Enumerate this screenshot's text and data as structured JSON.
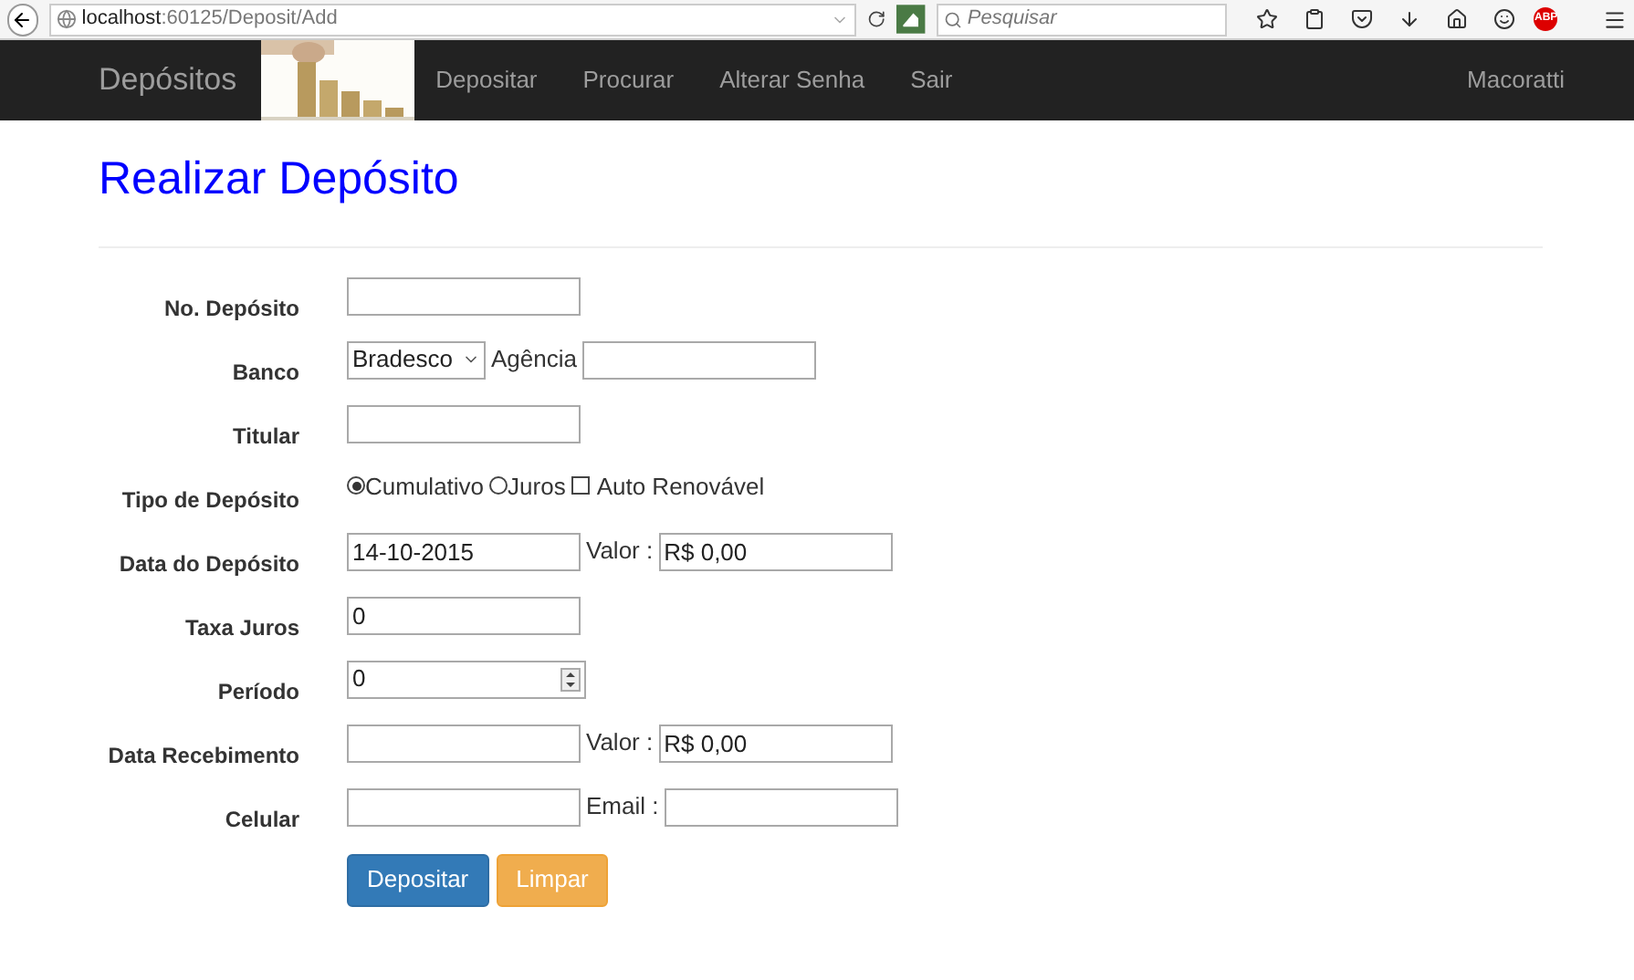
{
  "browser": {
    "url_host": "localhost",
    "url_path": ":60125/Deposit/Add",
    "search_placeholder": "Pesquisar",
    "addon_badge": "ABP"
  },
  "navbar": {
    "brand": "Depósitos",
    "links": [
      "Depositar",
      "Procurar",
      "Alterar Senha",
      "Sair"
    ],
    "user": "Macoratti"
  },
  "title": "Realizar Depósito",
  "rows": [
    {
      "label": "No. Depósito",
      "fields": [
        {
          "kind": "input"
        }
      ]
    },
    {
      "label": "Banco",
      "fields": [
        {
          "kind": "select",
          "value": "Bradesco"
        },
        {
          "kind": "text",
          "text": "Agência"
        },
        {
          "kind": "input"
        }
      ]
    },
    {
      "label": "Titular",
      "fields": [
        {
          "kind": "input"
        }
      ]
    },
    {
      "label": "Tipo de Depósito",
      "fields": [
        {
          "kind": "radio",
          "text": "Cumulativo",
          "selected": true
        },
        {
          "kind": "radio",
          "text": "Juros",
          "selected": false
        },
        {
          "kind": "checkbox",
          "text": "Auto Renovável",
          "checked": false
        }
      ]
    },
    {
      "label": "Data do Depósito",
      "fields": [
        {
          "kind": "input",
          "value": "14-10-2015"
        },
        {
          "kind": "text",
          "text": "Valor :"
        },
        {
          "kind": "input",
          "value": "R$ 0,00"
        }
      ]
    },
    {
      "label": "Taxa Juros",
      "fields": [
        {
          "kind": "input",
          "value": "0"
        }
      ]
    },
    {
      "label": "Período",
      "fields": [
        {
          "kind": "number",
          "value": "0"
        }
      ]
    },
    {
      "label": "Data Recebimento",
      "fields": [
        {
          "kind": "input"
        },
        {
          "kind": "text",
          "text": "Valor :"
        },
        {
          "kind": "input",
          "value": "R$ 0,00"
        }
      ]
    },
    {
      "label": "Celular",
      "fields": [
        {
          "kind": "input"
        },
        {
          "kind": "text",
          "text": "Email :"
        },
        {
          "kind": "input"
        }
      ]
    }
  ],
  "buttons": [
    {
      "label": "Depositar",
      "kind": "primary"
    },
    {
      "label": "Limpar",
      "kind": "warning"
    }
  ]
}
